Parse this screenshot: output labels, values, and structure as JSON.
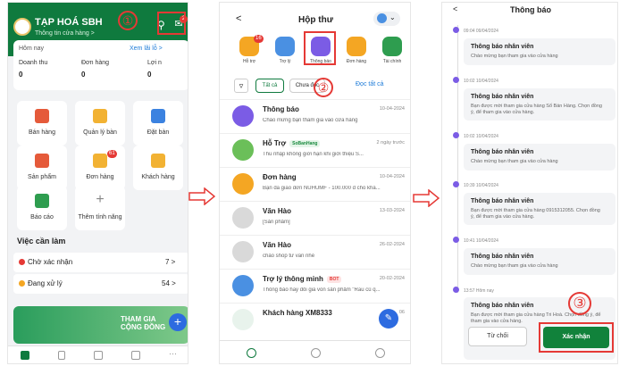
{
  "steps": {
    "one": "①",
    "two": "②",
    "three": "③"
  },
  "s1": {
    "store": "TẠP HOÁ SBH",
    "sub": "Thông tin cửa hàng >",
    "badge": "2",
    "today": "Hôm nay",
    "view_report": "Xem lãi lỗ >",
    "kpi": [
      {
        "label": "Doanh thu",
        "value": "0"
      },
      {
        "label": "Đơn hàng",
        "value": "0"
      },
      {
        "label": "Lợi n",
        "value": "0"
      }
    ],
    "tiles": [
      {
        "label": "Bán hàng"
      },
      {
        "label": "Quản lý bàn"
      },
      {
        "label": "Đặt bàn"
      },
      {
        "label": "Sản phẩm"
      },
      {
        "label": "Đơn hàng",
        "badge": "61"
      },
      {
        "label": "Khách hàng"
      },
      {
        "label": "Báo cáo"
      },
      {
        "label": "Thêm tính năng"
      }
    ],
    "tasks_title": "Việc cần làm",
    "tasks": [
      {
        "label": "Chờ xác nhận",
        "count": "7 >"
      },
      {
        "label": "Đang xử lý",
        "count": "54 >"
      }
    ],
    "banner": "THAM GIA CỘNG ĐỒNG"
  },
  "s2": {
    "back": "<",
    "title": "Hộp thư",
    "cats": [
      "Hỗ trợ",
      "Trợ lý",
      "Thông báo",
      "Đơn hàng",
      "Tài chính"
    ],
    "cat_badge": "16",
    "filter_all": "Tất cả",
    "filter_unread": "Chưa đọc",
    "read_all": "Đọc tất cả",
    "messages": [
      {
        "title": "Thông báo",
        "preview": "Chào mừng bạn tham gia vào cửa hàng",
        "date": "10-04-2024",
        "color": "#7b5ce5"
      },
      {
        "title": "Hỗ Trợ",
        "tag": "SoBanHang",
        "preview": "Thu nhập không giới hạn khi giới thiệu S...",
        "date": "2 ngày trước",
        "color": "#6bbf59"
      },
      {
        "title": "Đơn hàng",
        "preview": "Bạn đã giao đơn NUHUMF - 100.000 đ cho khá...",
        "date": "10-04-2024",
        "color": "#f4a623"
      },
      {
        "title": "Văn Hào",
        "preview": "[Sản phẩm]",
        "date": "13-03-2024",
        "color": "#cfcfcf"
      },
      {
        "title": "Văn Hào",
        "preview": "chào shop tư vấn nhé",
        "date": "26-02-2024",
        "color": "#cfcfcf"
      },
      {
        "title": "Trợ lý thông minh",
        "tag": "BOT",
        "preview": "Thông báo hay đổi giá vốn sản phẩm \"Rau củ q...",
        "date": "20-02-2024",
        "color": "#4a90e2"
      },
      {
        "title": "Khách hàng XM8333",
        "preview": "",
        "date": "06",
        "color": "#e8f3ec"
      }
    ]
  },
  "s3": {
    "back": "<",
    "title": "Thông báo",
    "items": [
      {
        "time": "09:04 09/04/2024",
        "title": "Thông báo nhân viên",
        "body": "Chào mừng bạn tham gia vào cửa hàng"
      },
      {
        "time": "10:02 10/04/2024",
        "title": "Thông báo nhân viên",
        "body": "Bạn được mời tham gia cửa hàng Sổ Bán Hàng. Chọn đồng ý, để tham gia vào cửa hàng."
      },
      {
        "time": "10:02 10/04/2024",
        "title": "Thông báo nhân viên",
        "body": "Chào mừng bạn tham gia vào cửa hàng"
      },
      {
        "time": "10:39 10/04/2024",
        "title": "Thông báo nhân viên",
        "body": "Bạn được mời tham gia cửa hàng 0915312055. Chọn đồng ý, để tham gia vào cửa hàng."
      },
      {
        "time": "10:41 10/04/2024",
        "title": "Thông báo nhân viên",
        "body": "Chào mừng bạn tham gia vào cửa hàng"
      },
      {
        "time": "13:57 Hôm nay",
        "title": "Thông báo nhân viên",
        "body": "Bạn được mời tham gia cửa hàng Tri Hoà. Chọn đồng ý, để tham gia vào cửa hàng."
      }
    ],
    "reject": "Từ chối",
    "accept": "Xác nhận"
  },
  "colors": {
    "brand": "#0f7a3e",
    "accent": "#e53935",
    "purple": "#7b5ce5"
  }
}
